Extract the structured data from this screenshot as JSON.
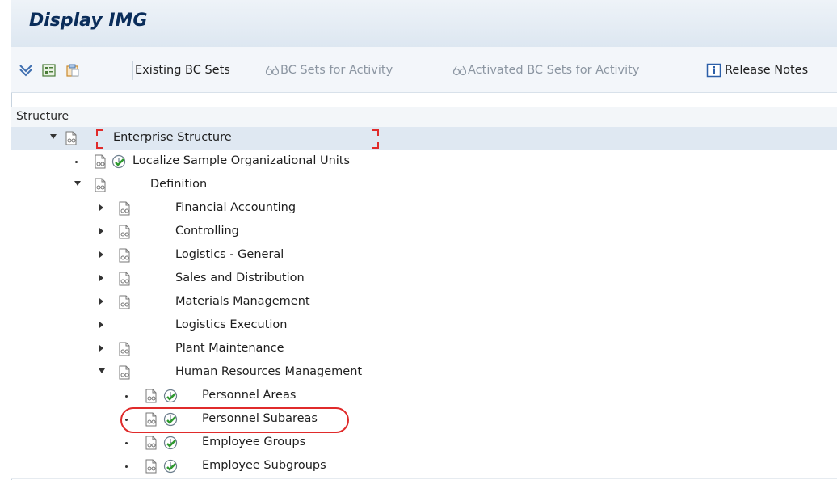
{
  "window": {
    "title": "Display IMG"
  },
  "toolbar": {
    "existing_bc_sets": "Existing BC Sets",
    "bc_sets_for_activity": "BC Sets for Activity",
    "activated_bc_sets_for_activity": "Activated BC Sets for Activity",
    "release_notes": "Release Notes"
  },
  "structure": {
    "header": "Structure",
    "items": [
      {
        "label": "Enterprise Structure"
      },
      {
        "label": "Localize Sample Organizational Units"
      },
      {
        "label": "Definition"
      },
      {
        "label": "Financial Accounting"
      },
      {
        "label": "Controlling"
      },
      {
        "label": "Logistics - General"
      },
      {
        "label": "Sales and Distribution"
      },
      {
        "label": "Materials Management"
      },
      {
        "label": "Logistics Execution"
      },
      {
        "label": "Plant Maintenance"
      },
      {
        "label": "Human Resources Management"
      },
      {
        "label": "Personnel Areas"
      },
      {
        "label": "Personnel Subareas"
      },
      {
        "label": "Employee Groups"
      },
      {
        "label": "Employee Subgroups"
      }
    ]
  },
  "colors": {
    "highlight_circle": "#e02b2b",
    "focus_brackets": "#e02b2b",
    "title": "#0a2d5a"
  }
}
